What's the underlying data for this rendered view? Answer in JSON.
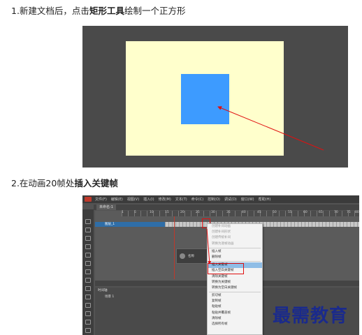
{
  "steps": [
    {
      "prefix": "1.新建文档后，点击",
      "bold": "矩形工具",
      "suffix": "绘制一个正方形"
    },
    {
      "prefix": "2.在动画20帧处",
      "bold": "插入关键帧",
      "suffix": ""
    }
  ],
  "figure1": {
    "canvas_color": "#ffffcc",
    "square_color": "#3d9bff",
    "arrow_color": "#e01010"
  },
  "figure2": {
    "menu": [
      "文件(F)",
      "编辑(E)",
      "视图(V)",
      "插入(I)",
      "修改(M)",
      "文本(T)",
      "命令(C)",
      "控制(O)",
      "调试(D)",
      "窗口(W)",
      "帮助(H)"
    ],
    "tab": "未命名-1",
    "ruler_ticks": [
      "1",
      "5",
      "10",
      "15",
      "20",
      "25",
      "30",
      "35",
      "40",
      "45",
      "50",
      "55",
      "60",
      "65",
      "70",
      "75",
      "80"
    ],
    "layer_name": "图层_1",
    "mini_label": "名称",
    "lower_tab": "时间轴",
    "scene": "场景 1",
    "context_menu": [
      {
        "label": "创建补间动画",
        "state": "dim"
      },
      {
        "label": "创建补间形状",
        "state": "dim"
      },
      {
        "label": "创建传统补间",
        "state": "dim"
      },
      {
        "label": "转换为逐帧动画",
        "state": "dim"
      },
      {
        "label": "插入帧",
        "state": "normal"
      },
      {
        "label": "删除帧",
        "state": "normal"
      },
      {
        "label": "插入关键帧",
        "state": "highlight"
      },
      {
        "label": "插入空白关键帧",
        "state": "normal"
      },
      {
        "label": "清除关键帧",
        "state": "normal"
      },
      {
        "label": "转换为关键帧",
        "state": "normal"
      },
      {
        "label": "转换为空白关键帧",
        "state": "normal"
      },
      {
        "label": "剪切帧",
        "state": "normal"
      },
      {
        "label": "复制帧",
        "state": "normal"
      },
      {
        "label": "粘贴帧",
        "state": "normal"
      },
      {
        "label": "粘贴并覆盖帧",
        "state": "normal"
      },
      {
        "label": "清除帧",
        "state": "normal"
      },
      {
        "label": "选择所有帧",
        "state": "normal"
      }
    ]
  },
  "watermark": "最需教育"
}
